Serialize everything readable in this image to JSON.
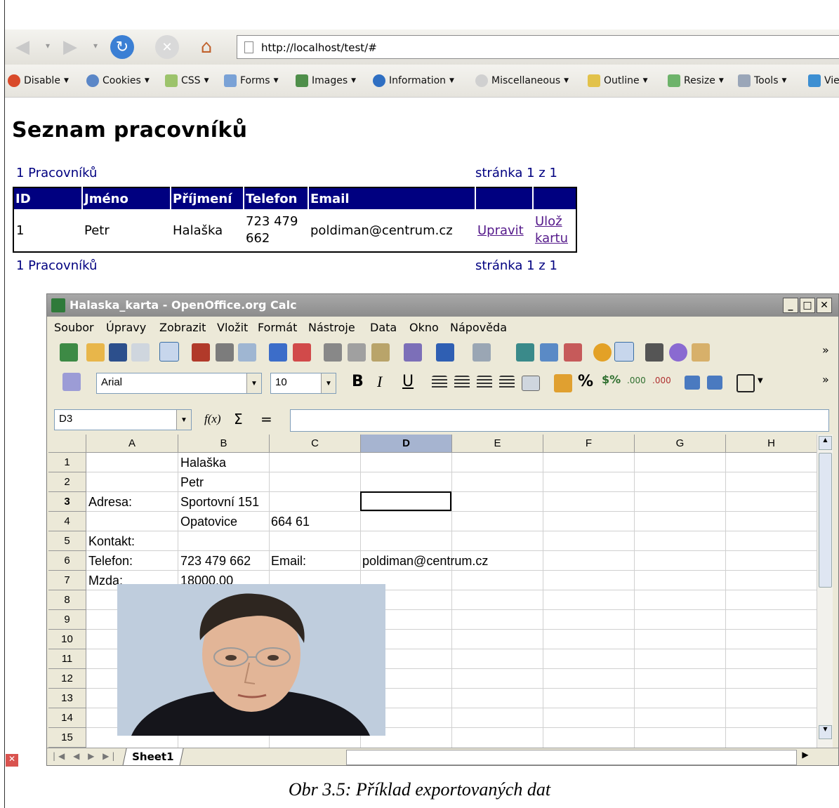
{
  "browser": {
    "url": "http://localhost/test/#",
    "devbar": [
      "Disable",
      "Cookies",
      "CSS",
      "Forms",
      "Images",
      "Information",
      "Miscellaneous",
      "Outline",
      "Resize",
      "Tools",
      "Vie"
    ]
  },
  "page": {
    "title": "Seznam pracovníků",
    "count_top": "1 Pracovníků",
    "pager_top": "stránka 1 z 1",
    "count_bottom": "1 Pracovníků",
    "pager_bottom": "stránka 1 z 1",
    "table": {
      "headers": [
        "ID",
        "Jméno",
        "Příjmení",
        "Telefon",
        "Email",
        "",
        ""
      ],
      "row": {
        "id": "1",
        "jmeno": "Petr",
        "prijmeni": "Halaška",
        "telefon": "723 479 662",
        "email": "poldiman@centrum.cz",
        "edit": "Upravit",
        "save": "Ulož kartu"
      }
    }
  },
  "calc": {
    "title": "Halaska_karta - OpenOffice.org Calc",
    "menu": [
      "Soubor",
      "Úpravy",
      "Zobrazit",
      "Vložit",
      "Formát",
      "Nástroje",
      "Data",
      "Okno",
      "Nápověda"
    ],
    "font": "Arial",
    "size": "10",
    "cell_ref": "D3",
    "fx": "f(x)",
    "sigma": "Σ",
    "equals": "=",
    "columns": [
      "A",
      "B",
      "C",
      "D",
      "E",
      "F",
      "G",
      "H"
    ],
    "rows": [
      "1",
      "2",
      "3",
      "4",
      "5",
      "6",
      "7",
      "8",
      "9",
      "10",
      "11",
      "12",
      "13",
      "14",
      "15"
    ],
    "cells": {
      "B1": "Halaška",
      "B2": "Petr",
      "A3": "Adresa:",
      "B3": "Sportovní 151",
      "B4": "Opatovice",
      "C4": "664 61",
      "A5": "Kontakt:",
      "A6": "Telefon:",
      "B6": "723 479 662",
      "C6": "Email:",
      "D6": "poldiman@centrum.cz",
      "A7": "Mzda:",
      "B7": "18000.00"
    },
    "sheet": "Sheet1"
  },
  "caption": "Obr 3.5: Příklad exportovaných dat"
}
